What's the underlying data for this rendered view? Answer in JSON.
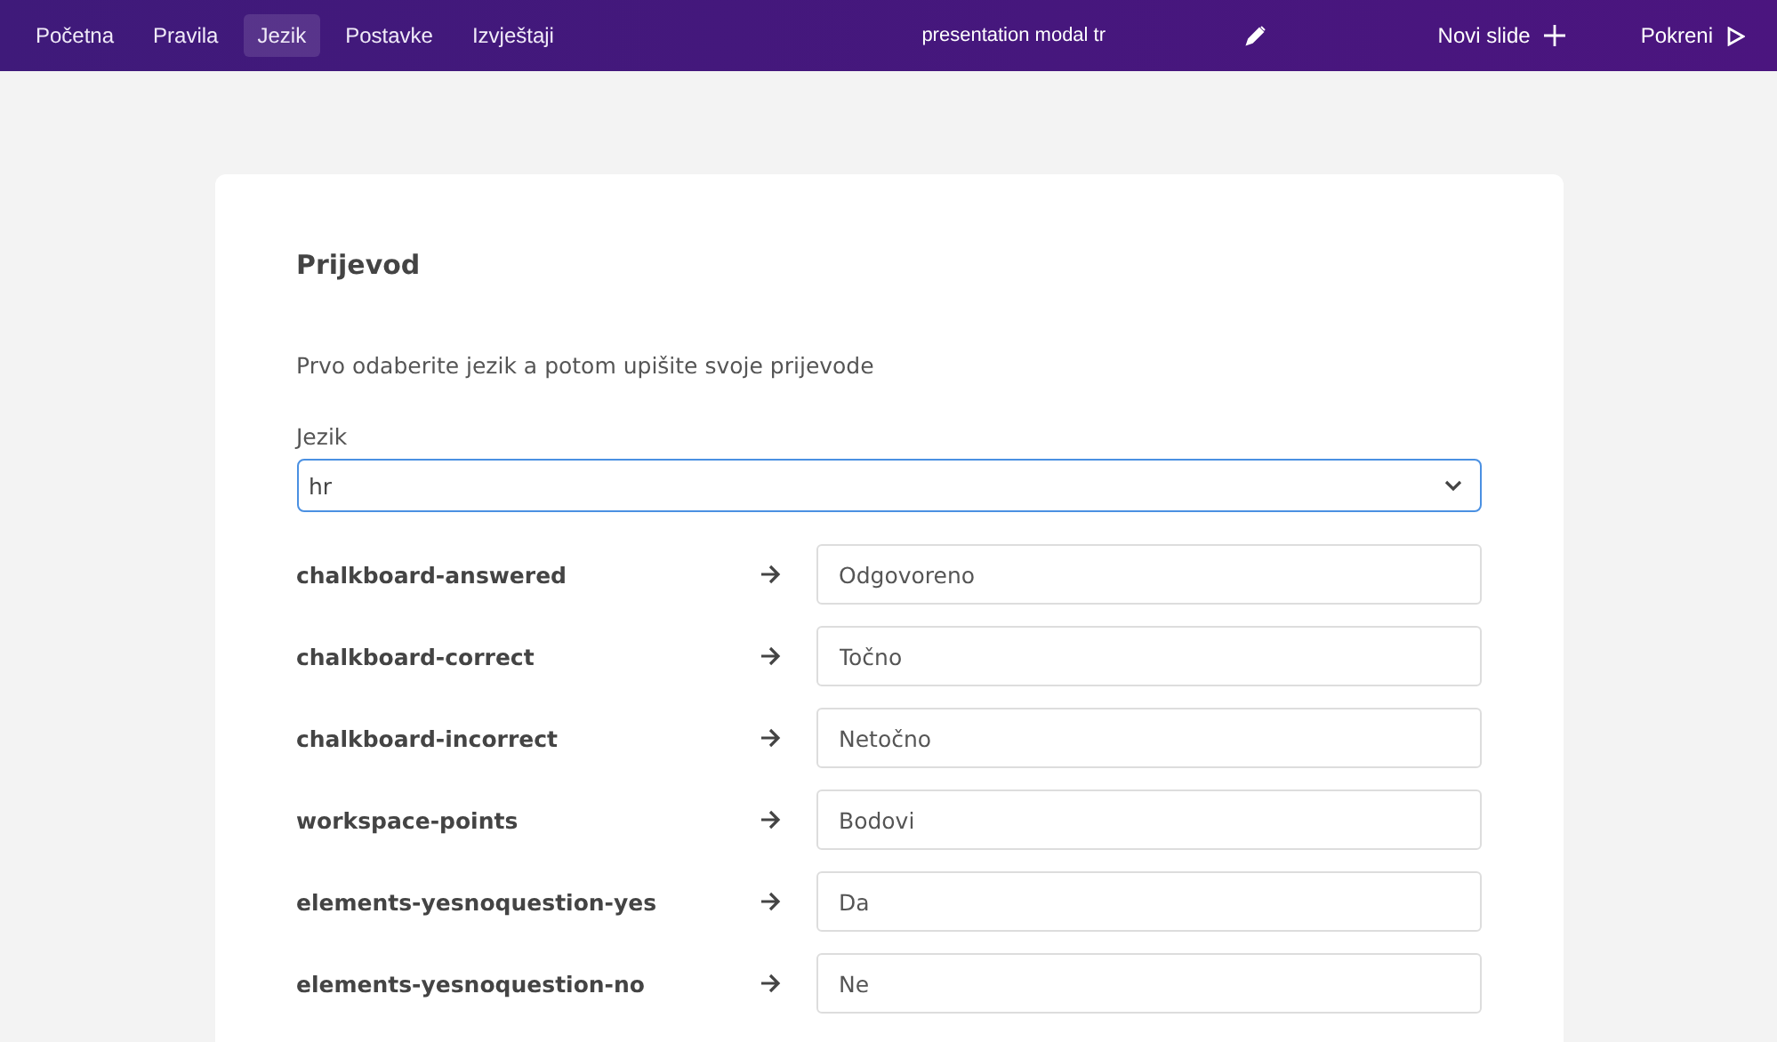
{
  "nav": {
    "items": [
      {
        "label": "Početna",
        "selected": false
      },
      {
        "label": "Pravila",
        "selected": false
      },
      {
        "label": "Jezik",
        "selected": true
      },
      {
        "label": "Postavke",
        "selected": false
      },
      {
        "label": "Izvještaji",
        "selected": false
      }
    ],
    "title": "presentation modal tr",
    "new_slide": "Novi slide",
    "start": "Pokreni"
  },
  "card": {
    "title": "Prijevod",
    "description": "Prvo odaberite jezik a potom upišite svoje prijevode",
    "language": {
      "label": "Jezik",
      "value": "hr"
    },
    "rows": [
      {
        "key": "chalkboard-answered",
        "value": "Odgovoreno"
      },
      {
        "key": "chalkboard-correct",
        "value": "Točno"
      },
      {
        "key": "chalkboard-incorrect",
        "value": "Netočno"
      },
      {
        "key": "workspace-points",
        "value": "Bodovi"
      },
      {
        "key": "elements-yesnoquestion-yes",
        "value": "Da"
      },
      {
        "key": "elements-yesnoquestion-no",
        "value": "Ne"
      }
    ]
  }
}
